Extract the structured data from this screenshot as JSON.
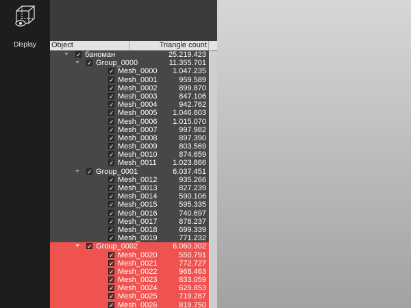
{
  "sidebar": {
    "display_label": "Display",
    "display_icon": "cube-eye-icon"
  },
  "tree": {
    "columns": {
      "object": "Object",
      "triangle_count": "Triangle count"
    },
    "rows": [
      {
        "name": "баноман",
        "count": "25.219.423",
        "depth": 0,
        "expandable": true,
        "checked": true,
        "selected": false
      },
      {
        "name": "Group_0000",
        "count": "11.355.701",
        "depth": 1,
        "expandable": true,
        "checked": true,
        "selected": false
      },
      {
        "name": "Mesh_0000",
        "count": "1.047.235",
        "depth": 2,
        "expandable": false,
        "checked": true,
        "selected": false
      },
      {
        "name": "Mesh_0001",
        "count": "959.589",
        "depth": 2,
        "expandable": false,
        "checked": true,
        "selected": false
      },
      {
        "name": "Mesh_0002",
        "count": "899.870",
        "depth": 2,
        "expandable": false,
        "checked": true,
        "selected": false
      },
      {
        "name": "Mesh_0003",
        "count": "847.106",
        "depth": 2,
        "expandable": false,
        "checked": true,
        "selected": false
      },
      {
        "name": "Mesh_0004",
        "count": "942.762",
        "depth": 2,
        "expandable": false,
        "checked": true,
        "selected": false
      },
      {
        "name": "Mesh_0005",
        "count": "1.046.603",
        "depth": 2,
        "expandable": false,
        "checked": true,
        "selected": false
      },
      {
        "name": "Mesh_0006",
        "count": "1.015.070",
        "depth": 2,
        "expandable": false,
        "checked": true,
        "selected": false
      },
      {
        "name": "Mesh_0007",
        "count": "997.982",
        "depth": 2,
        "expandable": false,
        "checked": true,
        "selected": false
      },
      {
        "name": "Mesh_0008",
        "count": "897.390",
        "depth": 2,
        "expandable": false,
        "checked": true,
        "selected": false
      },
      {
        "name": "Mesh_0009",
        "count": "803.569",
        "depth": 2,
        "expandable": false,
        "checked": true,
        "selected": false
      },
      {
        "name": "Mesh_0010",
        "count": "874.659",
        "depth": 2,
        "expandable": false,
        "checked": true,
        "selected": false
      },
      {
        "name": "Mesh_0011",
        "count": "1.023.866",
        "depth": 2,
        "expandable": false,
        "checked": true,
        "selected": false
      },
      {
        "name": "Group_0001",
        "count": "6.037.451",
        "depth": 1,
        "expandable": true,
        "checked": true,
        "selected": false
      },
      {
        "name": "Mesh_0012",
        "count": "935.266",
        "depth": 2,
        "expandable": false,
        "checked": true,
        "selected": false
      },
      {
        "name": "Mesh_0013",
        "count": "827.239",
        "depth": 2,
        "expandable": false,
        "checked": true,
        "selected": false
      },
      {
        "name": "Mesh_0014",
        "count": "590.106",
        "depth": 2,
        "expandable": false,
        "checked": true,
        "selected": false
      },
      {
        "name": "Mesh_0015",
        "count": "595.335",
        "depth": 2,
        "expandable": false,
        "checked": true,
        "selected": false
      },
      {
        "name": "Mesh_0016",
        "count": "740.697",
        "depth": 2,
        "expandable": false,
        "checked": true,
        "selected": false
      },
      {
        "name": "Mesh_0017",
        "count": "878.237",
        "depth": 2,
        "expandable": false,
        "checked": true,
        "selected": false
      },
      {
        "name": "Mesh_0018",
        "count": "699.339",
        "depth": 2,
        "expandable": false,
        "checked": true,
        "selected": false
      },
      {
        "name": "Mesh_0019",
        "count": "771.232",
        "depth": 2,
        "expandable": false,
        "checked": true,
        "selected": false
      },
      {
        "name": "Group_0002",
        "count": "6.060.302",
        "depth": 1,
        "expandable": true,
        "checked": true,
        "selected": true
      },
      {
        "name": "Mesh_0020",
        "count": "550.791",
        "depth": 2,
        "expandable": false,
        "checked": true,
        "selected": true
      },
      {
        "name": "Mesh_0021",
        "count": "772.727",
        "depth": 2,
        "expandable": false,
        "checked": true,
        "selected": true
      },
      {
        "name": "Mesh_0022",
        "count": "968.463",
        "depth": 2,
        "expandable": false,
        "checked": true,
        "selected": true
      },
      {
        "name": "Mesh_0023",
        "count": "833.059",
        "depth": 2,
        "expandable": false,
        "checked": true,
        "selected": true
      },
      {
        "name": "Mesh_0024",
        "count": "629.853",
        "depth": 2,
        "expandable": false,
        "checked": true,
        "selected": true
      },
      {
        "name": "Mesh_0025",
        "count": "719.287",
        "depth": 2,
        "expandable": false,
        "checked": true,
        "selected": true
      },
      {
        "name": "Mesh_0026",
        "count": "819.750",
        "depth": 2,
        "expandable": false,
        "checked": true,
        "selected": true
      }
    ]
  },
  "colors": {
    "selection": "#ef5350",
    "panel": "#474747",
    "sidebar": "#1d1d1d",
    "viewport_top": "#d7d7d7",
    "viewport_bottom": "#a2a2a2"
  }
}
